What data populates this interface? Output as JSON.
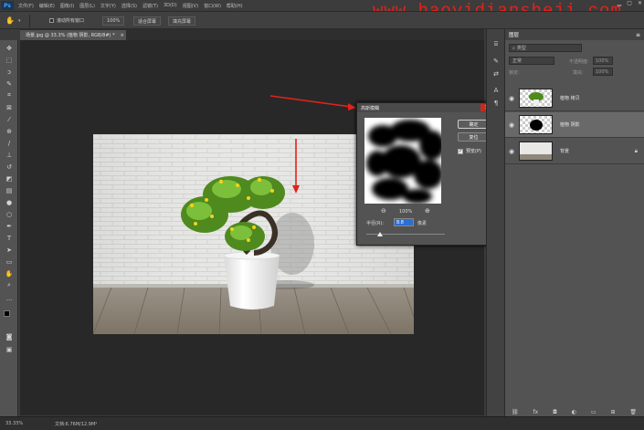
{
  "menu": {
    "logo": "Ps",
    "items": [
      "文件(F)",
      "编辑(E)",
      "图像(I)",
      "图层(L)",
      "文字(Y)",
      "选择(S)",
      "滤镜(T)",
      "3D(D)",
      "视图(V)",
      "窗口(W)",
      "帮助(H)"
    ]
  },
  "watermark": "www.haoyidiansheji.com",
  "options": {
    "scroll_all_label": "滚动所有窗口",
    "zoom_value": "100%",
    "fit_screen_label": "适合屏幕",
    "fill_screen_label": "填充屏幕"
  },
  "document": {
    "tab_title": "场景.jpg @ 33.3% (植物 阴影, RGB/8#) *",
    "tab_close": "×"
  },
  "dialog": {
    "title": "高斯模糊",
    "close": "×",
    "ok_label": "确定",
    "reset_label": "复位",
    "preview_label": "预览(P)",
    "zoom_out": "−",
    "zoom_level": "100%",
    "zoom_in": "+",
    "radius_label": "半径(R):",
    "radius_value": "8.8",
    "radius_unit": "像素",
    "radius_fraction": 0.18
  },
  "layers_panel": {
    "title": "图层",
    "search_placeholder": "类型",
    "blend_mode": "正常",
    "opacity_label": "不透明度:",
    "opacity_value": "100%",
    "lock_label": "锁定:",
    "fill_label": "填充:",
    "fill_value": "100%",
    "layers": [
      {
        "name": "植物 拷贝",
        "visible": true,
        "selected": false
      },
      {
        "name": "植物 阴影",
        "visible": true,
        "selected": true
      },
      {
        "name": "背景",
        "visible": true,
        "selected": false,
        "locked": true
      }
    ]
  },
  "status": {
    "zoom": "33.33%",
    "doc_info": "文档:6.76M/12.9M"
  },
  "colors": {
    "accent_red": "#e0231c",
    "panel_bg": "#535353",
    "canvas_bg": "#282828"
  }
}
